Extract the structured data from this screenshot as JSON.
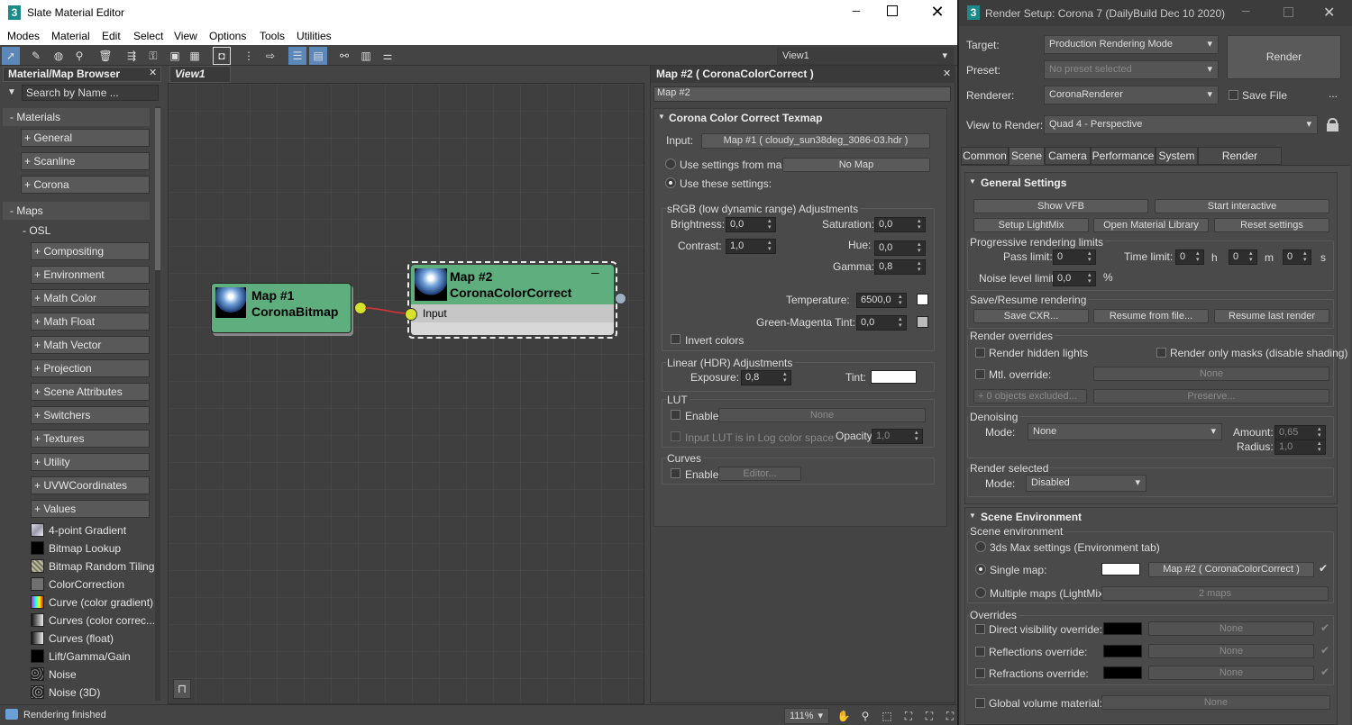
{
  "sme": {
    "title": "Slate Material Editor",
    "menu": [
      "Modes",
      "Material",
      "Edit",
      "Select",
      "View",
      "Options",
      "Tools",
      "Utilities"
    ],
    "view_dropdown": "View1",
    "browser": {
      "title": "Material/Map Browser",
      "search_placeholder": "Search by Name ...",
      "materials_label": "- Materials",
      "material_items": [
        "+ General",
        "+ Scanline",
        "+ Corona"
      ],
      "maps_label": "- Maps",
      "osl_label": "- OSL",
      "osl_items": [
        "+ Compositing",
        "+ Environment",
        "+ Math Color",
        "+ Math Float",
        "+ Math Vector",
        "+ Projection",
        "+ Scene Attributes",
        "+ Switchers",
        "+ Textures",
        "+ Utility",
        "+ UVWCoordinates",
        "+ Values"
      ],
      "maps": [
        {
          "name": "4-point Gradient",
          "swatch": "gradient4"
        },
        {
          "name": "Bitmap Lookup",
          "swatch": "black"
        },
        {
          "name": "Bitmap Random Tiling",
          "swatch": "tiling"
        },
        {
          "name": "ColorCorrection",
          "swatch": "grey"
        },
        {
          "name": "Curve (color gradient)",
          "swatch": "rainbow"
        },
        {
          "name": "Curves (color correc...",
          "swatch": "greygrad"
        },
        {
          "name": "Curves (float)",
          "swatch": "greygrad"
        },
        {
          "name": "Lift/Gamma/Gain",
          "swatch": "black"
        },
        {
          "name": "Noise",
          "swatch": "noise"
        },
        {
          "name": "Noise (3D)",
          "swatch": "noise"
        }
      ]
    },
    "view_tab": "View1",
    "node1": {
      "title": "Map #1",
      "subtitle": "CoronaBitmap"
    },
    "node2": {
      "title": "Map #2",
      "subtitle": "CoronaColorCorrect",
      "input": "Input"
    },
    "status": "Rendering finished",
    "zoom": "111%",
    "params": {
      "title": "Map #2  ( CoronaColorCorrect )",
      "name_field": "Map #2",
      "rollout": "Corona Color Correct Texmap",
      "input_label": "Input:",
      "input_map": "Map #1 ( cloudy_sun38deg_3086-03.hdr )",
      "use_from_map": "Use settings from map:",
      "no_map": "No Map",
      "use_these": "Use these settings:",
      "srgb_title": "sRGB (low dynamic range) Adjustments",
      "brightness_label": "Brightness:",
      "brightness": "0,0",
      "saturation_label": "Saturation:",
      "saturation": "0,0",
      "contrast_label": "Contrast:",
      "contrast": "1,0",
      "hue_label": "Hue:",
      "hue": "0,0",
      "gamma_label": "Gamma:",
      "gamma": "0,8",
      "temperature_label": "Temperature:",
      "temperature": "6500,0",
      "gm_label": "Green-Magenta Tint:",
      "gm": "0,0",
      "invert": "Invert colors",
      "linear_title": "Linear (HDR) Adjustments",
      "exposure_label": "Exposure:",
      "exposure": "0,8",
      "tint_label": "Tint:",
      "lut_title": "LUT",
      "enable": "Enable",
      "none": "None",
      "lut_log": "Input LUT is in Log color space",
      "opacity_label": "Opacity:",
      "opacity": "1,0",
      "curves_title": "Curves",
      "editor": "Editor..."
    }
  },
  "rs": {
    "title": "Render Setup: Corona 7 (DailyBuild Dec 10 2020)",
    "target_label": "Target:",
    "target": "Production Rendering Mode",
    "preset_label": "Preset:",
    "preset": "No preset selected",
    "renderer_label": "Renderer:",
    "renderer": "CoronaRenderer",
    "save_file": "Save File",
    "more": "...",
    "view_label": "View to Render:",
    "view": "Quad 4 - Perspective",
    "render_btn": "Render",
    "tabs": [
      "Common",
      "Scene",
      "Camera",
      "Performance",
      "System",
      "Render Elements"
    ],
    "general": {
      "title": "General Settings",
      "show_vfb": "Show VFB",
      "start_interactive": "Start interactive",
      "setup_lightmix": "Setup LightMix",
      "open_matlib": "Open Material Library",
      "reset": "Reset settings",
      "prog_limits": "Progressive rendering limits",
      "pass_label": "Pass limit:",
      "pass": "0",
      "time_label": "Time limit:",
      "h": "0",
      "h_unit": "h",
      "m": "0",
      "m_unit": "m",
      "s": "0",
      "s_unit": "s",
      "noise_label": "Noise level limit:",
      "noise": "0,0",
      "pct": "%",
      "save_resume": "Save/Resume rendering",
      "save_cxr": "Save CXR...",
      "resume_file": "Resume from file...",
      "resume_last": "Resume last render",
      "overrides": "Render overrides",
      "hidden_lights": "Render hidden lights",
      "only_masks": "Render only masks (disable shading)",
      "mtl_override": "Mtl. override:",
      "none": "None",
      "excluded": "+  0 objects excluded...",
      "preserve": "Preserve...",
      "denoising": "Denoising",
      "mode_label": "Mode:",
      "den_mode": "None",
      "amount_label": "Amount:",
      "amount": "0,65",
      "radius_label": "Radius:",
      "radius": "1,0",
      "render_selected": "Render selected",
      "rs_mode": "Disabled"
    },
    "env": {
      "title": "Scene Environment",
      "scene_env": "Scene environment",
      "max_settings": "3ds Max settings (Environment tab)",
      "single_map": "Single map:",
      "single_map_btn": "Map #2  ( CoronaColorCorrect )",
      "multi_maps": "Multiple maps (LightMix):",
      "two_maps": "2 maps",
      "overrides": "Overrides",
      "direct": "Direct visibility override:",
      "reflections": "Reflections override:",
      "refractions": "Refractions override:",
      "none": "None",
      "global_vol": "Global volume material:"
    }
  }
}
